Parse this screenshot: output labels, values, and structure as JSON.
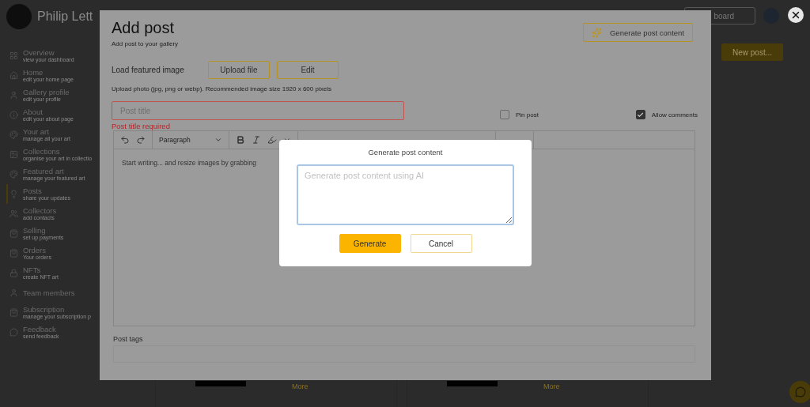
{
  "sidebar": {
    "brand": "Philip Lett",
    "items": [
      {
        "title": "Overview",
        "subtitle": "view your dashboard",
        "selected": false
      },
      {
        "title": "Home",
        "subtitle": "edit your home page",
        "selected": false
      },
      {
        "title": "Gallery profile",
        "subtitle": "edit your profile",
        "selected": false
      },
      {
        "title": "About",
        "subtitle": "edit your about page",
        "selected": false
      },
      {
        "title": "Your art",
        "subtitle": "manage all your art",
        "selected": false
      },
      {
        "title": "Collections",
        "subtitle": "organise your art in collectio",
        "selected": false
      },
      {
        "title": "Featured art",
        "subtitle": "manage your featured art",
        "selected": false
      },
      {
        "title": "Posts",
        "subtitle": "share your updates",
        "selected": true
      },
      {
        "title": "Collectors",
        "subtitle": "add contacts",
        "selected": false
      },
      {
        "title": "Selling",
        "subtitle": "set up payments",
        "selected": false
      },
      {
        "title": "Orders",
        "subtitle": "Your orders",
        "selected": false
      },
      {
        "title": "NFTs",
        "subtitle": "create NFT art",
        "selected": false
      },
      {
        "title": "Team members",
        "selected": false
      },
      {
        "title": "Subscription",
        "subtitle": "manage your subscription p",
        "selected": false
      },
      {
        "title": "Feedback",
        "subtitle": "send feedback",
        "selected": false
      }
    ]
  },
  "header": {
    "dashboard_button": "board",
    "new_post_button": "New post..."
  },
  "cards": [
    {
      "link": "More"
    },
    {
      "link": "More"
    }
  ],
  "post_dialog": {
    "title": "Add post",
    "subtitle": "Add post to your gallery",
    "generate_button": "Generate post content",
    "featured_label": "Load featured image",
    "upload_button": "Upload file",
    "edit_button": "Edit",
    "hint": "Upload photo (jpg, png or webp). Recommended image size 1920 x 600 pixels",
    "title_field": {
      "placeholder": "Post title",
      "error": "Post title required"
    },
    "options": [
      {
        "label": "Pin post",
        "checked": false
      },
      {
        "label": "Allow comments",
        "checked": true
      }
    ],
    "editor": {
      "format": "Paragraph",
      "placeholder": "Start writing... and resize images by grabbing"
    },
    "tags_label": "Post tags"
  },
  "generate_dialog": {
    "title": "Generate post content",
    "placeholder": "Generate post content using AI",
    "buttons": [
      {
        "label": "Generate",
        "kind": "primary"
      },
      {
        "label": "Cancel",
        "kind": "secondary"
      }
    ]
  }
}
